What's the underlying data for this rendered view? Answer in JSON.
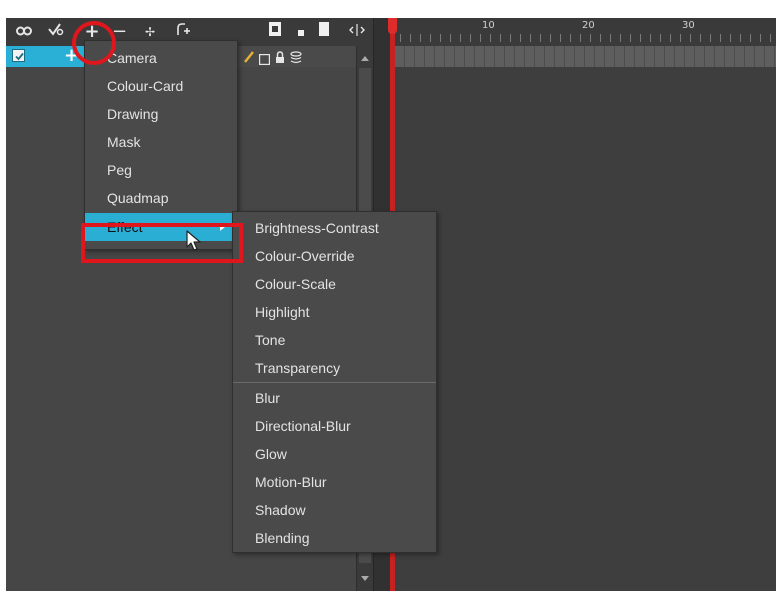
{
  "timeline": {
    "toolbar_icons": [
      "onion-skin-icon",
      "enable-disable-icon",
      "add-layer-icon",
      "delete-layer-icon",
      "add-peg-icon",
      "add-drawing-icon",
      "thumbnail-icon",
      "small-dot-icon",
      "column-icon",
      "expand-icon"
    ],
    "layer_row": {
      "checked": true,
      "plus_label": "+",
      "tool_icons": [
        "pencil-icon",
        "square-icon",
        "lock-icon",
        "layers-icon"
      ]
    },
    "ruler": {
      "marks": [
        "10",
        "20",
        "30"
      ]
    }
  },
  "add_layer_menu": {
    "items": [
      "Camera",
      "Colour-Card",
      "Drawing",
      "Mask",
      "Peg",
      "Quadmap",
      "Effect"
    ],
    "active_item": "Effect"
  },
  "effect_submenu": {
    "group1": [
      "Brightness-Contrast",
      "Colour-Override",
      "Colour-Scale",
      "Highlight",
      "Tone",
      "Transparency"
    ],
    "group2": [
      "Blur",
      "Directional-Blur",
      "Glow",
      "Motion-Blur",
      "Shadow",
      "Blending"
    ]
  },
  "colors": {
    "accent": "#2aaed4",
    "annotation_red": "#e0161d",
    "panel": "#464646",
    "menu": "#4a4a4a"
  }
}
